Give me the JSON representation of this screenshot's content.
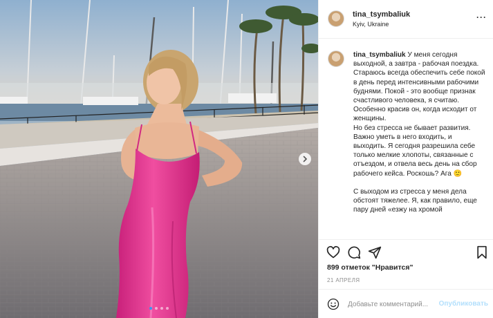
{
  "post": {
    "username": "tina_tsymbaliuk",
    "location": "Kyiv, Ukraine",
    "caption": "У меня сегодня выходной, а завтра - рабочая поездка. Стараюсь всегда обеспечить себе покой в день перед интенсивными рабочими буднями. Покой - это вообще признак счастливого человека, я считаю. Особенно красив он, когда исходит от женщины.\nНо без стресса не бывает развития. Важно уметь в него входить, и выходить. Я сегодня разрешила себе только мелкие хлопоты, связанные с отъездом, и отвела весь день на сбор рабочего кейса. Роскошь? Ага 🙂\n\nС выходом из стресса у меня дела обстоят тяжелее. Я, как правило, еще пару дней «езжу на хромой",
    "likes": "899 отметок \"Нравится\"",
    "date": "21 АПРЕЛЯ",
    "comment_placeholder": "Добавьте комментарий...",
    "post_button": "Опубликовать"
  },
  "carousel": {
    "slides": 4,
    "active": 0
  },
  "icons": [
    "heart-icon",
    "comment-icon",
    "share-icon",
    "bookmark-icon",
    "more-icon",
    "emoji-icon",
    "next-arrow-icon"
  ],
  "colors": {
    "accent": "#3897f0",
    "post_button_disabled": "#b2dffc",
    "dress": "#e8368f"
  }
}
